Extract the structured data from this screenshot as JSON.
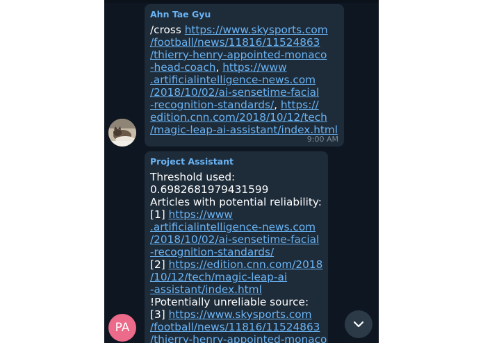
{
  "colors": {
    "chat_background": "#0e1621",
    "bubble_background": "#1e2c3a",
    "link": "#6ab3f3",
    "sender_name": "#6ab3f3",
    "avatar_pa": "#ec6a8a"
  },
  "messages": [
    {
      "sender": "Ahn Tae Gyu",
      "lines": [
        [
          {
            "t": "/cross "
          },
          {
            "t": "https://www.skysports.com",
            "link": true
          }
        ],
        [
          {
            "t": "/football/news/11816/11524863",
            "link": true
          }
        ],
        [
          {
            "t": "/thierry-henry-appointed-monaco",
            "link": true
          }
        ],
        [
          {
            "t": "-head-coach",
            "link": true
          },
          {
            "t": ", "
          },
          {
            "t": "https://www",
            "link": true
          }
        ],
        [
          {
            "t": ".artificialintelligence-news.com",
            "link": true
          }
        ],
        [
          {
            "t": "/2018/10/02/ai-sensetime-facial",
            "link": true
          }
        ],
        [
          {
            "t": "-recognition-standards/",
            "link": true
          },
          {
            "t": ", "
          },
          {
            "t": "https://",
            "link": true
          }
        ],
        [
          {
            "t": "edition.cnn.com/2018/10/12/tech",
            "link": true
          }
        ],
        [
          {
            "t": "/magic-leap-ai-assistant/index.html",
            "link": true
          }
        ]
      ],
      "time": "9:00 AM",
      "avatar_icon": "cat-photo-avatar"
    },
    {
      "sender": "Project Assistant",
      "lines": [
        [
          {
            "t": "Threshold used:"
          }
        ],
        [
          {
            "t": "0.6982681979431599"
          }
        ],
        [
          {
            "t": "Articles with potential reliability:"
          }
        ],
        [
          {
            "t": "[1] "
          },
          {
            "t": "https://www",
            "link": true
          }
        ],
        [
          {
            "t": ".artificialintelligence-news.com",
            "link": true
          }
        ],
        [
          {
            "t": "/2018/10/02/ai-sensetime-facial",
            "link": true
          }
        ],
        [
          {
            "t": "-recognition-standards/",
            "link": true
          }
        ],
        [
          {
            "t": "[2] "
          },
          {
            "t": "https://edition.cnn.com/2018",
            "link": true
          }
        ],
        [
          {
            "t": "/10/12/tech/magic-leap-ai",
            "link": true
          }
        ],
        [
          {
            "t": "-assistant/index.html",
            "link": true
          }
        ],
        [
          {
            "t": "!Potentially unreliable source:"
          }
        ],
        [
          {
            "t": "[3] "
          },
          {
            "t": "https://www.skysports.com",
            "link": true
          }
        ],
        [
          {
            "t": "/football/news/11816/11524863",
            "link": true
          }
        ],
        [
          {
            "t": "/thierry-henry-appointed-monaco",
            "link": true
          }
        ]
      ],
      "avatar_initials": "PA"
    }
  ],
  "scroll_button_icon": "chevron-down-icon"
}
